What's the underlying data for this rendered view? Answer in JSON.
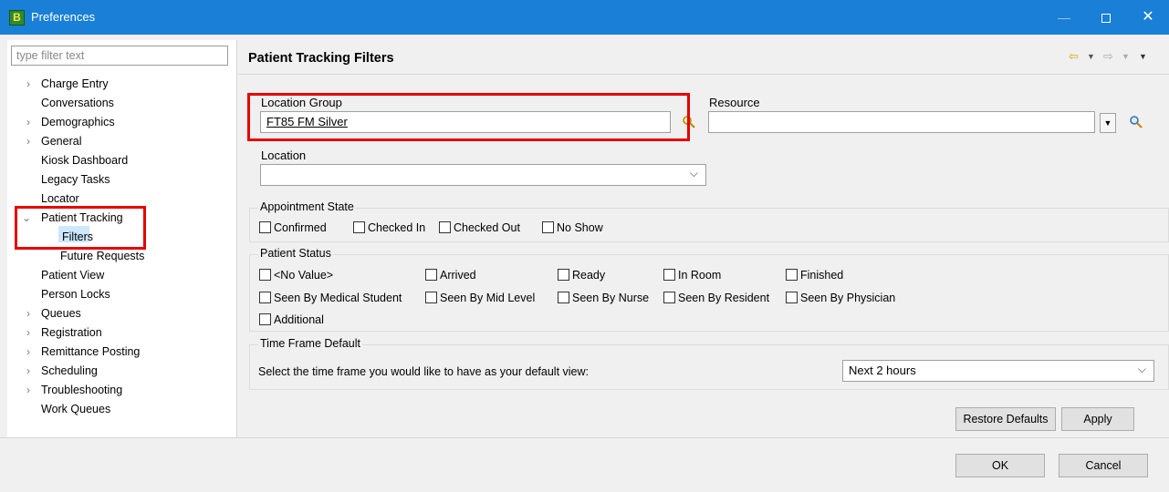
{
  "window": {
    "title": "Preferences",
    "icon": "B",
    "controls": {
      "minimize": "—",
      "close": "✕"
    }
  },
  "sidebar": {
    "filter_placeholder": "type filter text",
    "items": [
      {
        "label": "Charge Entry",
        "expandable": true
      },
      {
        "label": "Conversations",
        "expandable": false
      },
      {
        "label": "Demographics",
        "expandable": true
      },
      {
        "label": "General",
        "expandable": true
      },
      {
        "label": "Kiosk Dashboard",
        "expandable": false
      },
      {
        "label": "Legacy Tasks",
        "expandable": false
      },
      {
        "label": "Locator",
        "expandable": false
      },
      {
        "label": "Patient Tracking",
        "expandable": true,
        "expanded": true
      },
      {
        "label": "Filters",
        "child": true,
        "selected": true
      },
      {
        "label": "Future Requests",
        "child": true
      },
      {
        "label": "Patient View",
        "expandable": false
      },
      {
        "label": "Person Locks",
        "expandable": false
      },
      {
        "label": "Queues",
        "expandable": true
      },
      {
        "label": "Registration",
        "expandable": true
      },
      {
        "label": "Remittance Posting",
        "expandable": true
      },
      {
        "label": "Scheduling",
        "expandable": true
      },
      {
        "label": "Troubleshooting",
        "expandable": true
      },
      {
        "label": "Work Queues",
        "expandable": false
      }
    ]
  },
  "page": {
    "title": "Patient Tracking Filters",
    "location_group": {
      "label": "Location Group",
      "value": "FT85 FM Silver"
    },
    "resource": {
      "label": "Resource",
      "value": ""
    },
    "location": {
      "label": "Location",
      "value": ""
    },
    "appointment_state": {
      "title": "Appointment State",
      "options": [
        "Confirmed",
        "Checked In",
        "Checked Out",
        "No Show"
      ]
    },
    "patient_status": {
      "title": "Patient Status",
      "row1": [
        "<No Value>",
        "Arrived",
        "Ready",
        "In Room",
        "Finished"
      ],
      "row2": [
        "Seen By Medical Student",
        "Seen By Mid Level",
        "Seen By Nurse",
        "Seen By Resident",
        "Seen By Physician"
      ],
      "row3": [
        "Additional"
      ]
    },
    "time_frame": {
      "title": "Time Frame Default",
      "prompt": "Select the time frame you would like to have as your default view:",
      "value": "Next 2 hours"
    },
    "buttons": {
      "restore_defaults": "Restore Defaults",
      "apply": "Apply"
    }
  },
  "footer": {
    "ok": "OK",
    "cancel": "Cancel"
  },
  "colors": {
    "titlebar": "#1a7fd6",
    "highlight": "#e60000",
    "selection": "#cde8ff"
  }
}
